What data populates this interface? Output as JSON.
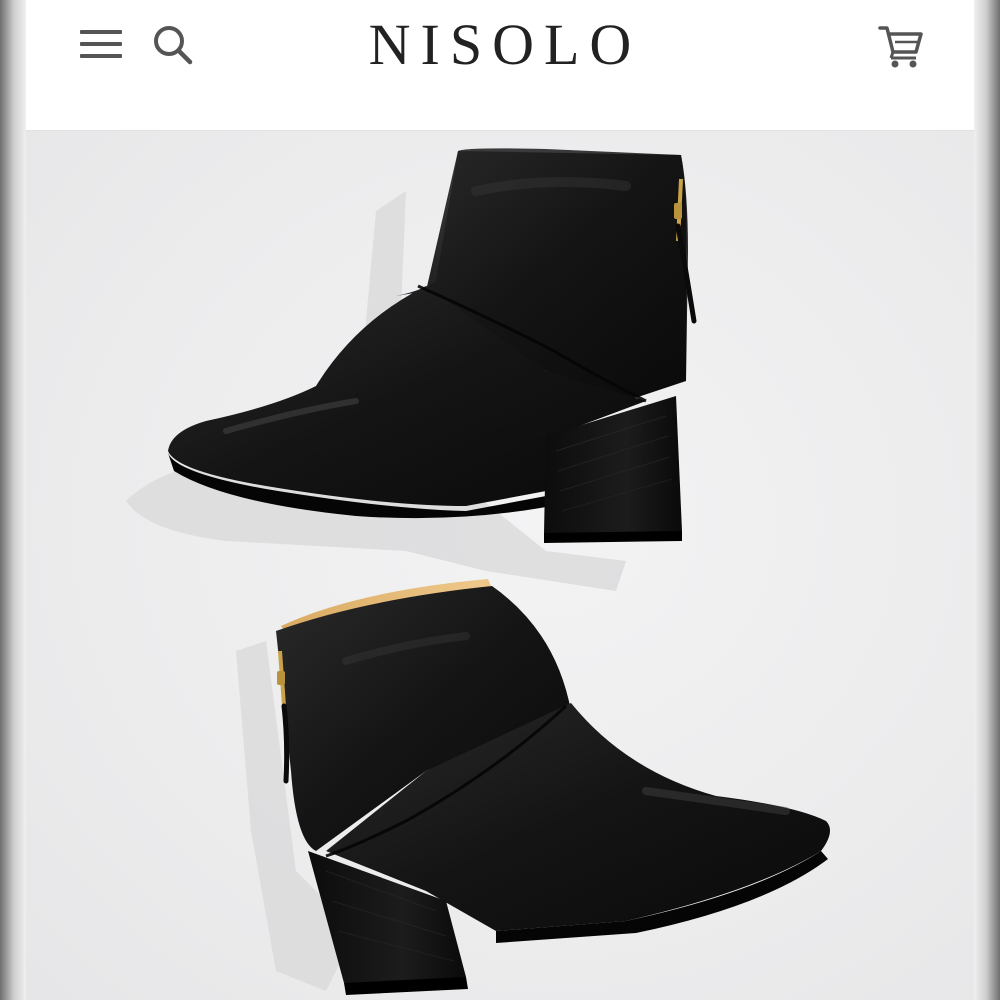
{
  "header": {
    "logo_text": "NISOLO",
    "menu_icon": "hamburger-menu-icon",
    "search_icon": "search-icon",
    "cart_icon": "shopping-cart-icon"
  },
  "hero": {
    "image_subject": "product-photo-black-leather-ankle-boots"
  },
  "colors": {
    "header_bg": "#ffffff",
    "page_bg": "#efeff0",
    "logo": "#222222",
    "icon": "#555555",
    "leather": "#151515",
    "zipper": "#c9a24a",
    "lining": "#e3b978"
  }
}
